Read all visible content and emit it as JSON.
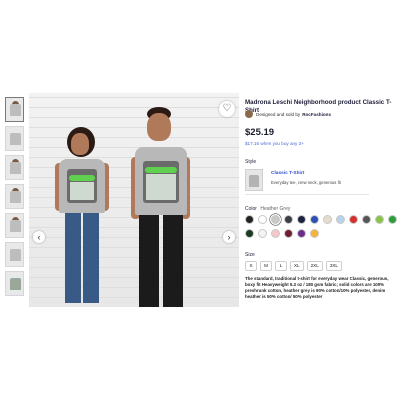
{
  "product": {
    "title": "Madrona Leschi Neighborhood product Classic T-Shirt",
    "seller_prefix": "Designed and sold by",
    "seller_name": "RocFashions",
    "price": "$25.19",
    "bulk_price": "$17.16 when you buy any 3+"
  },
  "style": {
    "label": "Style",
    "name": "Classic T-Shirt",
    "description": "Everyday tee, crew neck, generous fit"
  },
  "color": {
    "label": "Color",
    "selected_name": "Heather Grey",
    "swatches_row1": [
      "#222222",
      "#ffffff",
      "#c9c9c9",
      "#3a3f47",
      "#1c2340",
      "#2b4fb3",
      "#e6dccb",
      "#b9d3ea",
      "#d32f2f",
      "#555555",
      "#8bc34a",
      "#2e9e3a"
    ],
    "swatches_row2": [
      "#1b3a22",
      "#f3f3f3",
      "#f4c7c9",
      "#6e1e2e",
      "#6a2d8c",
      "#f2b43a"
    ],
    "selected_index": 2
  },
  "size": {
    "label": "Size",
    "options": [
      "S",
      "M",
      "L",
      "XL",
      "2XL",
      "3XL"
    ]
  },
  "description": "The standard, traditional t-shirt for everyday wear Classic, generous, boxy fit Heavyweight 5.3 oz / 180 gsm fabric; solid colors are 100% preshrunk cotton, heather grey is 90% cotton/10% polyester, denim heather is 50% cotton/ 50% polyester",
  "icons": {
    "favorite": "heart-icon",
    "prev": "chevron-left-icon",
    "next": "chevron-right-icon"
  },
  "thumbnail_count": 7
}
